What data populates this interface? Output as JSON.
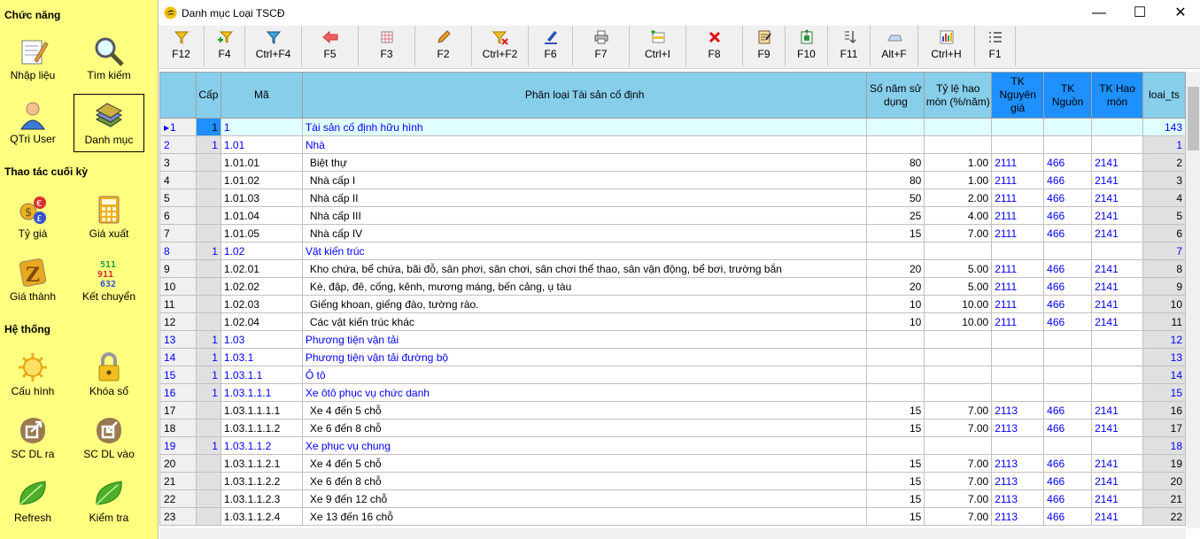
{
  "sidebar": {
    "sections": [
      "Chức năng",
      "Thao tác cuối kỳ",
      "Hệ thống"
    ],
    "items": [
      {
        "label": "Nhập liệu",
        "icon": "notepad-pencil-icon"
      },
      {
        "label": "Tìm kiếm",
        "icon": "magnifier-icon"
      },
      {
        "label": "QTri User",
        "icon": "user-icon"
      },
      {
        "label": "Danh mục",
        "icon": "books-icon"
      },
      {
        "label": "Tỷ giá",
        "icon": "currency-icon"
      },
      {
        "label": "Giá xuất",
        "icon": "calculator-icon"
      },
      {
        "label": "Giá thành",
        "icon": "zeta-icon"
      },
      {
        "label": "Kết chuyển",
        "icon": "numbers-icon"
      },
      {
        "label": "Cấu hình",
        "icon": "sun-gear-icon"
      },
      {
        "label": "Khóa sổ",
        "icon": "padlock-icon"
      },
      {
        "label": "SC DL ra",
        "icon": "export-icon"
      },
      {
        "label": "SC DL vào",
        "icon": "import-icon"
      },
      {
        "label": "Refresh",
        "icon": "leaf-icon"
      },
      {
        "label": "Kiểm tra",
        "icon": "leaf-icon"
      }
    ]
  },
  "window": {
    "title": "Danh mục Loại TSCĐ",
    "minimize": "—",
    "maximize": "☐",
    "close": "✕"
  },
  "toolbar": [
    {
      "label": "F12",
      "icon": "filter-icon"
    },
    {
      "label": "F4",
      "icon": "filter-add-icon"
    },
    {
      "label": "Ctrl+F4",
      "icon": "filter-blue-icon"
    },
    {
      "label": "F5",
      "icon": "back-arrow-icon"
    },
    {
      "label": "F3",
      "icon": "grid-icon"
    },
    {
      "label": "F2",
      "icon": "pencil-icon"
    },
    {
      "label": "Ctrl+F2",
      "icon": "filter-remove-icon"
    },
    {
      "label": "F6",
      "icon": "edit-icon"
    },
    {
      "label": "F7",
      "icon": "printer-icon"
    },
    {
      "label": "Ctrl+I",
      "icon": "insert-icon"
    },
    {
      "label": "F8",
      "icon": "delete-icon"
    },
    {
      "label": "F9",
      "icon": "report-icon"
    },
    {
      "label": "F10",
      "icon": "export-excel-icon"
    },
    {
      "label": "F11",
      "icon": "sort-icon"
    },
    {
      "label": "Alt+F",
      "icon": "keyboard-icon"
    },
    {
      "label": "Ctrl+H",
      "icon": "chart-icon"
    },
    {
      "label": "F1",
      "icon": "list-icon"
    }
  ],
  "grid": {
    "columns": [
      "Cấp",
      "Mã",
      "Phân loại Tài sản cố định",
      "Số năm sử dụng",
      "Tỷ lệ hao mòn (%/năm)",
      "TK Nguyên giá",
      "TK Nguồn",
      "TK Hao mòn",
      "loai_ts"
    ],
    "rows": [
      {
        "n": "1",
        "cap": "1",
        "ma": "1",
        "ten": "Tài sản cố định hữu hình",
        "nam": "",
        "tyle": "",
        "tkng": "",
        "tknguon": "",
        "tkhm": "",
        "lts": "143"
      },
      {
        "n": "2",
        "cap": "1",
        "ma": "1.01",
        "ten": "Nhà",
        "nam": "",
        "tyle": "",
        "tkng": "",
        "tknguon": "",
        "tkhm": "",
        "lts": "1"
      },
      {
        "n": "3",
        "cap": "",
        "ma": "1.01.01",
        "ten": "Biệt thự",
        "nam": "80",
        "tyle": "1.00",
        "tkng": "2111",
        "tknguon": "466",
        "tkhm": "2141",
        "lts": "2"
      },
      {
        "n": "4",
        "cap": "",
        "ma": "1.01.02",
        "ten": "Nhà cấp I",
        "nam": "80",
        "tyle": "1.00",
        "tkng": "2111",
        "tknguon": "466",
        "tkhm": "2141",
        "lts": "3"
      },
      {
        "n": "5",
        "cap": "",
        "ma": "1.01.03",
        "ten": "Nhà cấp II",
        "nam": "50",
        "tyle": "2.00",
        "tkng": "2111",
        "tknguon": "466",
        "tkhm": "2141",
        "lts": "4"
      },
      {
        "n": "6",
        "cap": "",
        "ma": "1.01.04",
        "ten": "Nhà cấp III",
        "nam": "25",
        "tyle": "4.00",
        "tkng": "2111",
        "tknguon": "466",
        "tkhm": "2141",
        "lts": "5"
      },
      {
        "n": "7",
        "cap": "",
        "ma": "1.01.05",
        "ten": "Nhà cấp IV",
        "nam": "15",
        "tyle": "7.00",
        "tkng": "2111",
        "tknguon": "466",
        "tkhm": "2141",
        "lts": "6"
      },
      {
        "n": "8",
        "cap": "1",
        "ma": "1.02",
        "ten": "Vật kiến trúc",
        "nam": "",
        "tyle": "",
        "tkng": "",
        "tknguon": "",
        "tkhm": "",
        "lts": "7"
      },
      {
        "n": "9",
        "cap": "",
        "ma": "1.02.01",
        "ten": "Kho chứa, bể chứa, bãi đỗ, sân phơi, sân chơi, sân chơi thể thao, sân vận động, bể bơi, trường bắn",
        "nam": "20",
        "tyle": "5.00",
        "tkng": "2111",
        "tknguon": "466",
        "tkhm": "2141",
        "lts": "8"
      },
      {
        "n": "10",
        "cap": "",
        "ma": "1.02.02",
        "ten": "Kè, đập, đê, cống, kênh, mương máng, bến cảng, ụ tàu",
        "nam": "20",
        "tyle": "5.00",
        "tkng": "2111",
        "tknguon": "466",
        "tkhm": "2141",
        "lts": "9"
      },
      {
        "n": "11",
        "cap": "",
        "ma": "1.02.03",
        "ten": "Giếng khoan, giếng đào, tường rào.",
        "nam": "10",
        "tyle": "10.00",
        "tkng": "2111",
        "tknguon": "466",
        "tkhm": "2141",
        "lts": "10"
      },
      {
        "n": "12",
        "cap": "",
        "ma": "1.02.04",
        "ten": "Các vật kiến trúc khác",
        "nam": "10",
        "tyle": "10.00",
        "tkng": "2111",
        "tknguon": "466",
        "tkhm": "2141",
        "lts": "11"
      },
      {
        "n": "13",
        "cap": "1",
        "ma": "1.03",
        "ten": "Phương tiện vận tải",
        "nam": "",
        "tyle": "",
        "tkng": "",
        "tknguon": "",
        "tkhm": "",
        "lts": "12"
      },
      {
        "n": "14",
        "cap": "1",
        "ma": "1.03.1",
        "ten": "Phương tiện vận tải đường bộ",
        "nam": "",
        "tyle": "",
        "tkng": "",
        "tknguon": "",
        "tkhm": "",
        "lts": "13"
      },
      {
        "n": "15",
        "cap": "1",
        "ma": "1.03.1.1",
        "ten": "Ô tô",
        "nam": "",
        "tyle": "",
        "tkng": "",
        "tknguon": "",
        "tkhm": "",
        "lts": "14"
      },
      {
        "n": "16",
        "cap": "1",
        "ma": "1.03.1.1.1",
        "ten": "Xe ôtô phục vụ chức danh",
        "nam": "",
        "tyle": "",
        "tkng": "",
        "tknguon": "",
        "tkhm": "",
        "lts": "15"
      },
      {
        "n": "17",
        "cap": "",
        "ma": "1.03.1.1.1.1",
        "ten": "Xe 4 đến 5 chỗ",
        "nam": "15",
        "tyle": "7.00",
        "tkng": "2113",
        "tknguon": "466",
        "tkhm": "2141",
        "lts": "16"
      },
      {
        "n": "18",
        "cap": "",
        "ma": "1.03.1.1.1.2",
        "ten": "Xe 6 đến 8 chỗ",
        "nam": "15",
        "tyle": "7.00",
        "tkng": "2113",
        "tknguon": "466",
        "tkhm": "2141",
        "lts": "17"
      },
      {
        "n": "19",
        "cap": "1",
        "ma": "1.03.1.1.2",
        "ten": "Xe phục vụ chung",
        "nam": "",
        "tyle": "",
        "tkng": "",
        "tknguon": "",
        "tkhm": "",
        "lts": "18"
      },
      {
        "n": "20",
        "cap": "",
        "ma": "1.03.1.1.2.1",
        "ten": "Xe 4 đến 5 chỗ",
        "nam": "15",
        "tyle": "7.00",
        "tkng": "2113",
        "tknguon": "466",
        "tkhm": "2141",
        "lts": "19"
      },
      {
        "n": "21",
        "cap": "",
        "ma": "1.03.1.1.2.2",
        "ten": "Xe 6 đến 8 chỗ",
        "nam": "15",
        "tyle": "7.00",
        "tkng": "2113",
        "tknguon": "466",
        "tkhm": "2141",
        "lts": "20"
      },
      {
        "n": "22",
        "cap": "",
        "ma": "1.03.1.1.2.3",
        "ten": "Xe 9 đến 12 chỗ",
        "nam": "15",
        "tyle": "7.00",
        "tkng": "2113",
        "tknguon": "466",
        "tkhm": "2141",
        "lts": "21"
      },
      {
        "n": "23",
        "cap": "",
        "ma": "1.03.1.1.2.4",
        "ten": "Xe 13 đến 16 chỗ",
        "nam": "15",
        "tyle": "7.00",
        "tkng": "2113",
        "tknguon": "466",
        "tkhm": "2141",
        "lts": "22"
      }
    ]
  }
}
